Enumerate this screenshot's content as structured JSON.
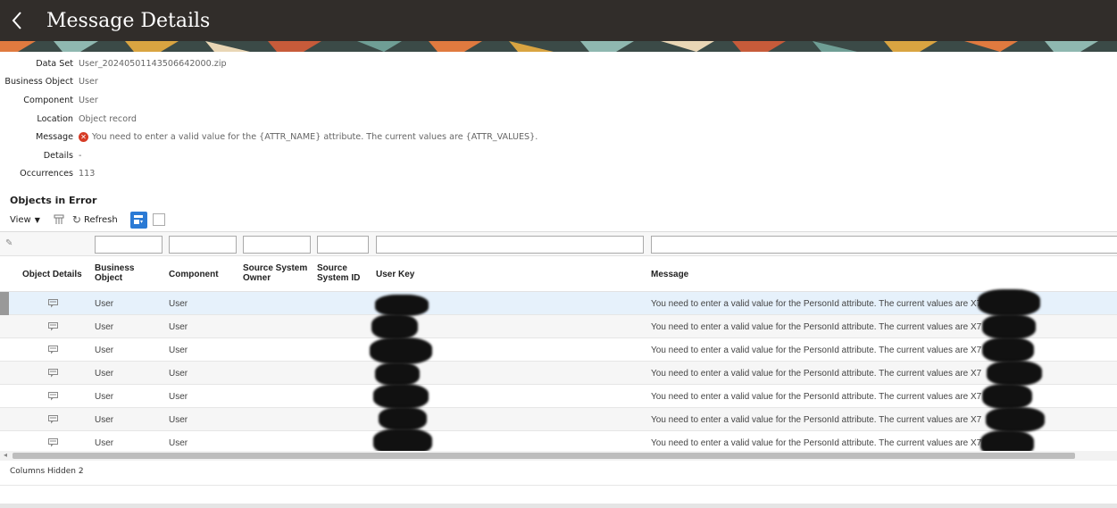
{
  "header": {
    "title": "Message Details"
  },
  "form": {
    "fields": [
      {
        "label": "Data Set",
        "value": "User_20240501143506642000.zip"
      },
      {
        "label": "Business Object",
        "value": "User"
      },
      {
        "label": "Component",
        "value": "User"
      },
      {
        "label": "Location",
        "value": "Object record"
      },
      {
        "label": "Message",
        "value": "You need to enter a valid value for the {ATTR_NAME} attribute. The current values are {ATTR_VALUES}."
      },
      {
        "label": "Details",
        "value": "-"
      },
      {
        "label": "Occurrences",
        "value": "113"
      }
    ]
  },
  "section": {
    "title": "Objects in Error"
  },
  "toolbar": {
    "view_label": "View",
    "refresh_label": "Refresh"
  },
  "table": {
    "headers": {
      "object_details": "Object Details",
      "business_object": "Business Object",
      "component": "Component",
      "source_system_owner": "Source System Owner",
      "source_system_id": "Source System ID",
      "user_key": "User Key",
      "message": "Message"
    },
    "rows": [
      {
        "business_object": "User",
        "component": "User",
        "message": "You need to enter a valid value for the PersonId attribute. The current values are X7"
      },
      {
        "business_object": "User",
        "component": "User",
        "message": "You need to enter a valid value for the PersonId attribute. The current values are X7"
      },
      {
        "business_object": "User",
        "component": "User",
        "message": "You need to enter a valid value for the PersonId attribute. The current values are X7"
      },
      {
        "business_object": "User",
        "component": "User",
        "message": "You need to enter a valid value for the PersonId attribute. The current values are X7"
      },
      {
        "business_object": "User",
        "component": "User",
        "message": "You need to enter a valid value for the PersonId attribute. The current values are X7"
      },
      {
        "business_object": "User",
        "component": "User",
        "message": "You need to enter a valid value for the PersonId attribute. The current values are X7"
      },
      {
        "business_object": "User",
        "component": "User",
        "message": "You need to enter a valid value for the PersonId attribute. The current values are X7"
      }
    ]
  },
  "footer": {
    "label": "Columns Hidden",
    "value": "2"
  },
  "colors": {
    "header_bg": "#312d2a",
    "accent": "#2a7ad5",
    "selected_row": "#e6f1fb",
    "error": "#d63b25"
  }
}
